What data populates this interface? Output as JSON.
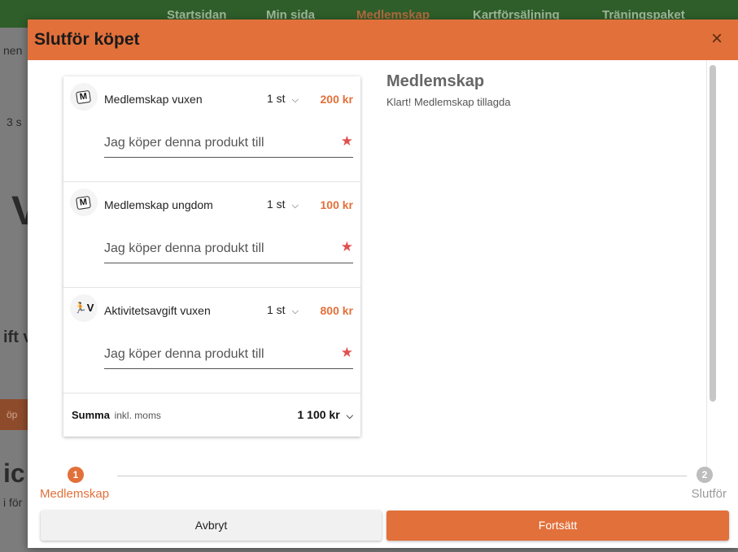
{
  "background": {
    "nav": [
      "Startsidan",
      "Min sida",
      "Medlemskap",
      "Kartförsäljning",
      "Träningspaket"
    ],
    "fragments": [
      "nen",
      "3 s",
      "V",
      "ift v",
      "ic",
      "i för"
    ],
    "button_fragment": "öp"
  },
  "modal": {
    "title": "Slutför köpet",
    "close_icon": "×",
    "cart": {
      "items": [
        {
          "icon": "ticket-icon",
          "icon_text": "M",
          "name": "Medlemskap vuxen",
          "qty": "1 st",
          "price": "200 kr",
          "placeholder": "Jag köper denna produkt till"
        },
        {
          "icon": "ticket-icon",
          "icon_text": "M",
          "name": "Medlemskap ungdom",
          "qty": "1 st",
          "price": "100 kr",
          "placeholder": "Jag köper denna produkt till"
        },
        {
          "icon": "runner-icon",
          "icon_text": "🏃V",
          "name": "Aktivitetsavgift vuxen",
          "qty": "1 st",
          "price": "800 kr",
          "placeholder": "Jag köper denna produkt till"
        }
      ],
      "required_marker": "★",
      "chevron": "⌵",
      "summary": {
        "label": "Summa",
        "sublabel": "inkl. moms",
        "total": "1 100 kr"
      }
    },
    "info": {
      "title": "Medlemskap",
      "text": "Klart! Medlemskap tillagda"
    },
    "stepper": [
      {
        "number": "1",
        "label": "Medlemskap",
        "active": true
      },
      {
        "number": "2",
        "label": "Slutför",
        "active": false
      }
    ],
    "buttons": {
      "cancel": "Avbryt",
      "continue": "Fortsätt"
    }
  },
  "colors": {
    "accent": "#e2703a",
    "nav_bg": "#2f5e2a"
  }
}
